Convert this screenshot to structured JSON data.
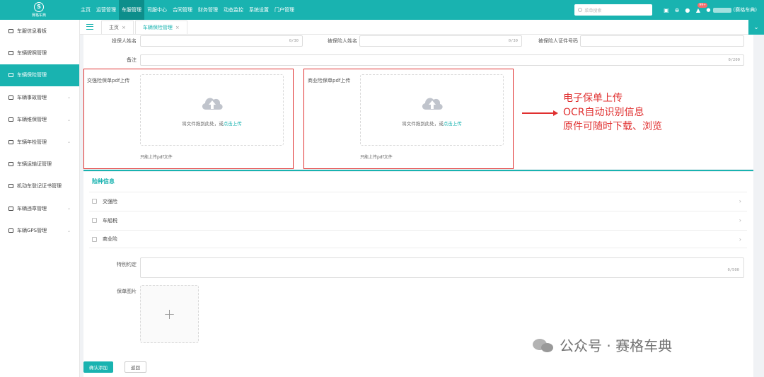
{
  "brand": {
    "name": "赛格车典"
  },
  "nav": [
    "主页",
    "运营管理",
    "车服管理",
    "司服中心",
    "合同管理",
    "财务管理",
    "动态监控",
    "系统设置",
    "门户管理"
  ],
  "nav_active_index": 2,
  "search": {
    "placeholder": "菜单搜索"
  },
  "notifications_badge": "99+",
  "user": {
    "name": "(赛格车典)"
  },
  "sidebar": [
    "车服信息看板",
    "车辆牌照管理",
    "车辆保险管理",
    "车辆事故管理",
    "车辆维保管理",
    "车辆年检管理",
    "车辆运输证管理",
    "机动车登记证书管理",
    "车辆违章管理",
    "车辆GPS管理"
  ],
  "sidebar_active_index": 2,
  "tabs": [
    {
      "label": "主页"
    },
    {
      "label": "车辆保险管理"
    }
  ],
  "form": {
    "policyholder_label": "投保人姓名",
    "policyholder_counter": "0/30",
    "insured_label": "被保险人姓名",
    "insured_counter": "0/30",
    "insured_id_label": "被保险人证件号码",
    "remark_label": "备注",
    "remark_counter": "0/200",
    "compulsory_upload_label": "交强险保单pdf上传",
    "commercial_upload_label": "商业险保单pdf上传",
    "drop_text": "将文件拖到此处，或",
    "drop_link": "点击上传",
    "upload_hint": "只能上传pdf文件"
  },
  "annotation": [
    "电子保单上传",
    "OCR自动识别信息",
    "原件可随时下载、浏览"
  ],
  "insurance": {
    "title": "险种信息",
    "items": [
      "交强险",
      "车船税",
      "商业险"
    ],
    "special_label": "特别约定",
    "special_counter": "0/500",
    "image_label": "保单图片",
    "image_plus": "+"
  },
  "footer": {
    "confirm": "确认添加",
    "back": "返回"
  },
  "watermark": "公众号 · 赛格车典",
  "colors": {
    "primary": "#19b3b0",
    "annotation": "#e03030"
  }
}
